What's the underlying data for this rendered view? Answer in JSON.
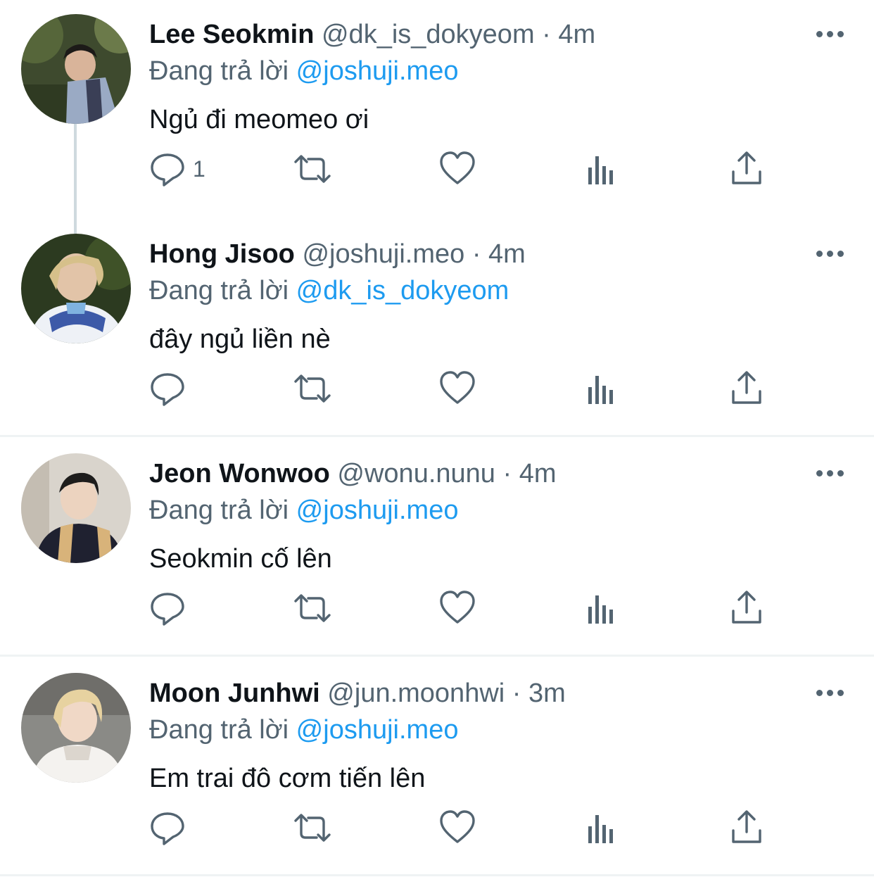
{
  "tweets": [
    {
      "name": "Lee Seokmin",
      "handle": "@dk_is_dokyeom",
      "separator": "·",
      "time": "4m",
      "replying_prefix": "Đang trả lời",
      "replying_to": "@joshuji.meo",
      "text": "Ngủ đi meomeo ơi",
      "reply_count": "1"
    },
    {
      "name": "Hong Jisoo",
      "handle": "@joshuji.meo",
      "separator": "·",
      "time": "4m",
      "replying_prefix": "Đang trả lời",
      "replying_to": "@dk_is_dokyeom",
      "text": "đây ngủ liền nè",
      "reply_count": ""
    },
    {
      "name": "Jeon Wonwoo",
      "handle": "@wonu.nunu",
      "separator": "·",
      "time": "4m",
      "replying_prefix": "Đang trả lời",
      "replying_to": "@joshuji.meo",
      "text": "Seokmin cố lên",
      "reply_count": ""
    },
    {
      "name": "Moon Junhwi",
      "handle": "@jun.moonhwi",
      "separator": "·",
      "time": "3m",
      "replying_prefix": "Đang trả lời",
      "replying_to": "@joshuji.meo",
      "text": "Em trai đô cơm tiến lên",
      "reply_count": ""
    }
  ],
  "icons": {
    "reply": "reply-icon",
    "retweet": "retweet-icon",
    "like": "heart-icon",
    "views": "views-icon",
    "share": "share-icon",
    "more": "more-icon"
  },
  "colors": {
    "text": "#0f1419",
    "secondary": "#536471",
    "link": "#1d9bf0",
    "divider": "#eff3f4",
    "thread_line": "#cfd9de"
  }
}
